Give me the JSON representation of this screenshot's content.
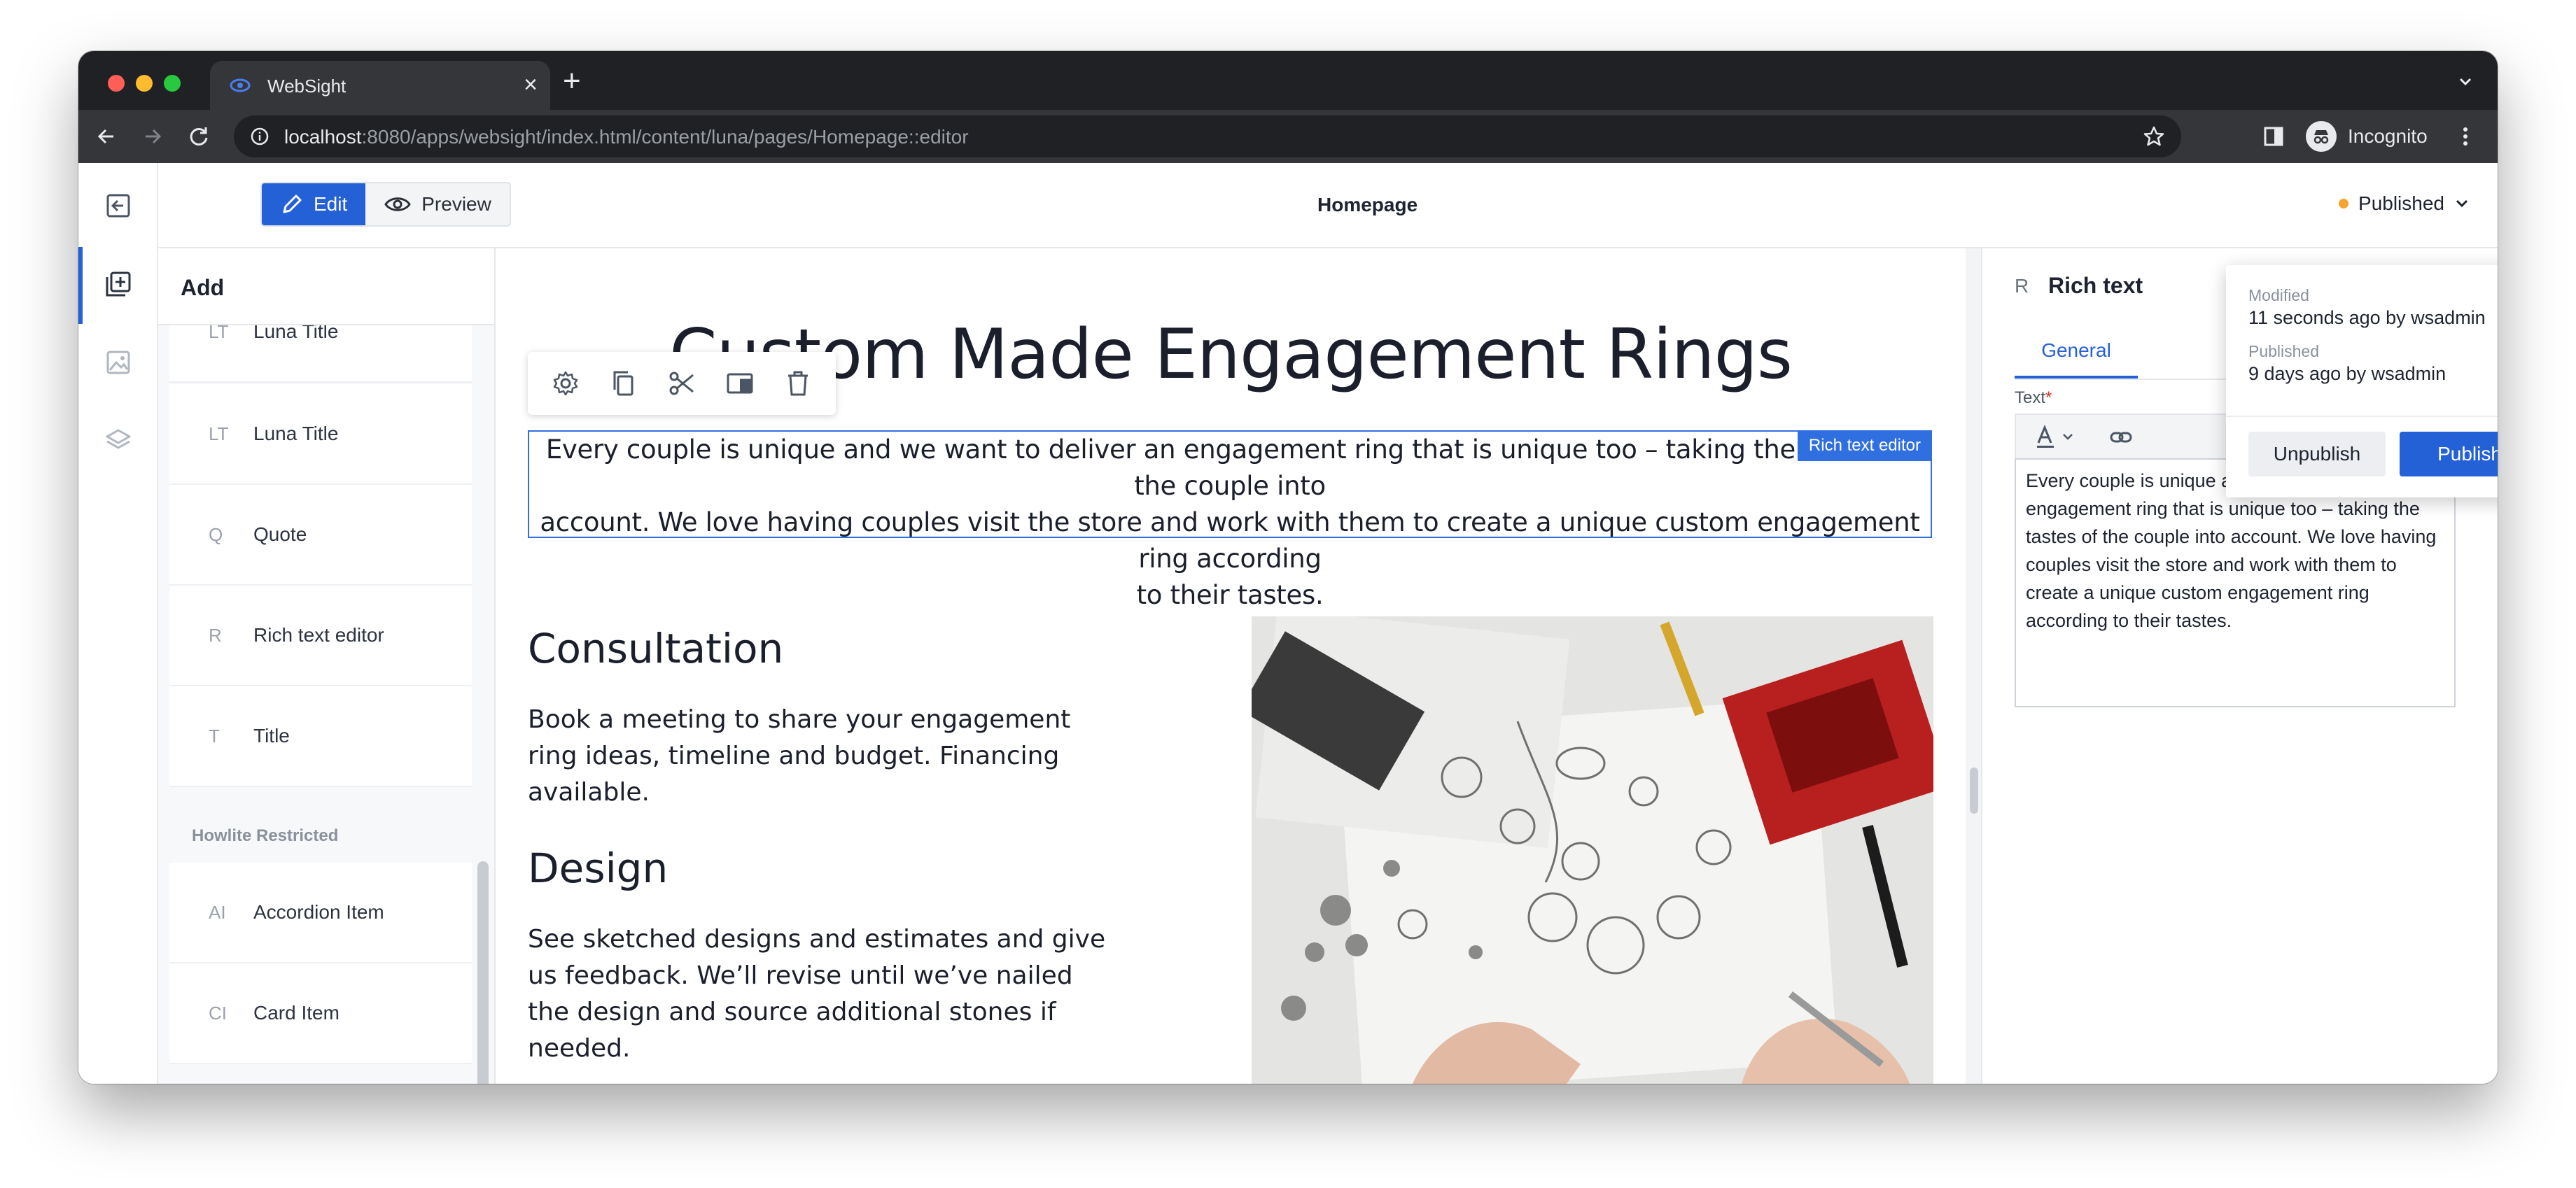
{
  "browser": {
    "tab_title": "WebSight",
    "url_host": "localhost",
    "url_rest": ":8080/apps/websight/index.html/content/luna/pages/Homepage::editor",
    "profile_label": "Incognito"
  },
  "header": {
    "edit_label": "Edit",
    "preview_label": "Preview",
    "page_name": "Homepage",
    "status_label": "Published"
  },
  "add_panel": {
    "title": "Add",
    "components": [
      {
        "abbr": "LT",
        "name": "Luna Title"
      },
      {
        "abbr": "LT",
        "name": "Luna Title"
      },
      {
        "abbr": "Q",
        "name": "Quote"
      },
      {
        "abbr": "R",
        "name": "Rich text editor"
      },
      {
        "abbr": "T",
        "name": "Title"
      }
    ],
    "group_label": "Howlite Restricted",
    "group_components": [
      {
        "abbr": "AI",
        "name": "Accordion Item"
      },
      {
        "abbr": "CI",
        "name": "Card Item"
      }
    ]
  },
  "page": {
    "heading": "Custom Made Engagement Rings",
    "intro_line1": "Every couple is unique and we want to deliver an engagement ring that is unique too – taking the tastes of the couple into",
    "intro_line2": "account. We love having couples visit the store and work with them to create a unique custom engagement ring according",
    "intro_line3": "to their tastes.",
    "rich_badge": "Rich text editor",
    "consultation_title": "Consultation",
    "consultation_text": "Book a meeting to share your engagement ring ideas, timeline and budget. Financing available.",
    "design_title": "Design",
    "design_text": "See sketched designs and estimates and give us feedback. We’ll revise until we’ve nailed the design and source additional stones if needed."
  },
  "properties": {
    "abbr": "R",
    "title": "Rich text",
    "tab_general": "General",
    "text_label": "Text",
    "required_mark": "*",
    "text_value": "Every couple is unique and we want to deliver an engagement ring that is unique too – taking the tastes of the couple into account. We love having couples visit the store and work with them to create a unique custom engagement ring according to their tastes."
  },
  "publish_popover": {
    "modified_label": "Modified",
    "modified_value": "11 seconds ago by wsadmin",
    "published_label": "Published",
    "published_value": "9 days ago by wsadmin",
    "unpublish_label": "Unpublish",
    "publish_label": "Publish"
  },
  "colors": {
    "accent": "#2460d6",
    "status_dot": "#f4a431",
    "selection": "#2f6fe0"
  }
}
